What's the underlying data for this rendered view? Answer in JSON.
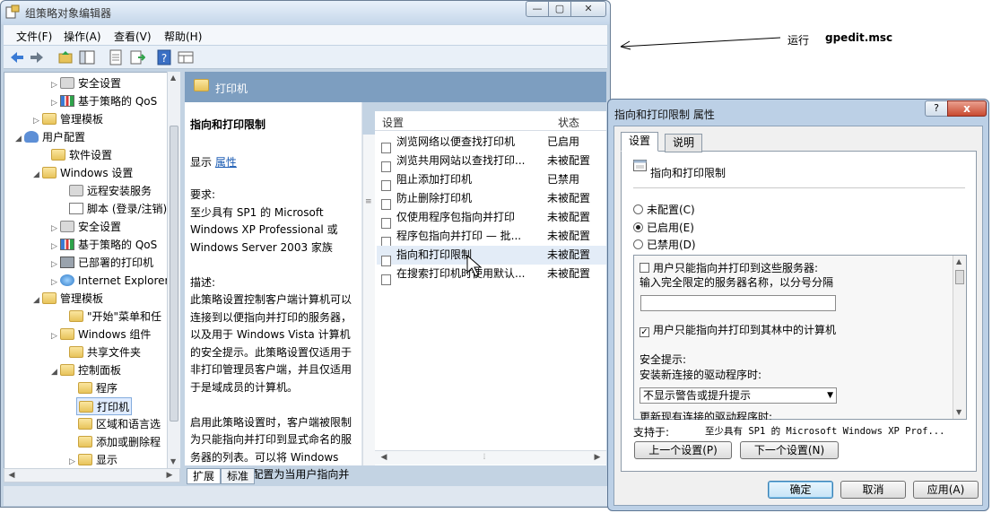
{
  "main_window": {
    "title": "组策略对象编辑器",
    "menu": [
      "文件(F)",
      "操作(A)",
      "查看(V)",
      "帮助(H)"
    ],
    "tree": [
      {
        "label": "安全设置",
        "icon": "security-settings-icon"
      },
      {
        "label": "基于策略的 QoS",
        "icon": "qos-chart-icon"
      },
      {
        "label": "管理模板",
        "icon": "folder-icon"
      },
      {
        "label": "用户配置",
        "icon": "user-config-icon"
      },
      {
        "label": "软件设置",
        "icon": "folder-icon"
      },
      {
        "label": "Windows 设置",
        "icon": "folder-icon"
      },
      {
        "label": "远程安装服务",
        "icon": "remote-install-icon"
      },
      {
        "label": "脚本 (登录/注销)",
        "icon": "script-icon"
      },
      {
        "label": "安全设置",
        "icon": "security-settings-icon"
      },
      {
        "label": "基于策略的 QoS",
        "icon": "qos-chart-icon"
      },
      {
        "label": "已部署的打印机",
        "icon": "printer-icon"
      },
      {
        "label": "Internet Explorer",
        "icon": "ie-globe-icon"
      },
      {
        "label": "管理模板",
        "icon": "folder-icon"
      },
      {
        "label": "\"开始\"菜单和任",
        "icon": "folder-icon"
      },
      {
        "label": "Windows 组件",
        "icon": "folder-icon"
      },
      {
        "label": "共享文件夹",
        "icon": "folder-icon"
      },
      {
        "label": "控制面板",
        "icon": "folder-icon"
      },
      {
        "label": "程序",
        "icon": "folder-icon"
      },
      {
        "label": "打印机",
        "icon": "folder-icon",
        "selected": true
      },
      {
        "label": "区域和语言选",
        "icon": "folder-icon"
      },
      {
        "label": "添加或删除程",
        "icon": "folder-icon"
      },
      {
        "label": "显示",
        "icon": "folder-icon"
      }
    ],
    "right_header_title": "打印机",
    "description": {
      "heading": "指向和打印限制",
      "show_prefix": "显示",
      "show_link": "属性",
      "body": "要求:\n至少具有 SP1 的 Microsoft\nWindows XP Professional 或\nWindows Server 2003 家族\n\n描述:\n此策略设置控制客户端计算机可以\n连接到以便指向并打印的服务器，\n以及用于 Windows Vista 计算机\n的安全提示。此策略设置仅适用于\n非打印管理员客户端，并且仅适用\n于是域成员的计算机。\n\n启用此策略设置时，客户端被限制\n为只能指向并打印到显式命名的服\n务器的列表。可以将 Windows\nVista 客户端配置为当用户指向并"
    },
    "list_columns": {
      "setting": "设置",
      "state": "状态"
    },
    "settings": [
      {
        "name": "浏览网络以便查找打印机",
        "state": "已启用"
      },
      {
        "name": "浏览共用网站以查找打印...",
        "state": "未被配置"
      },
      {
        "name": "阻止添加打印机",
        "state": "已禁用"
      },
      {
        "name": "防止删除打印机",
        "state": "未被配置"
      },
      {
        "name": "仅使用程序包指向并打印",
        "state": "未被配置"
      },
      {
        "name": "程序包指向并打印 — 批...",
        "state": "未被配置"
      },
      {
        "name": "指向和打印限制",
        "state": "未被配置",
        "highlighted": true
      },
      {
        "name": "在搜索打印机时使用默认...",
        "state": "未被配置"
      }
    ],
    "bottom_tabs": [
      "扩展",
      "标准"
    ]
  },
  "annotation": {
    "run_label": "运行",
    "command": "gpedit.msc"
  },
  "dialog": {
    "title": "指向和打印限制 属性",
    "close_label": "x",
    "help_label": "?",
    "tabs": [
      "设置",
      "说明"
    ],
    "policy_name": "指向和打印限制",
    "radios": [
      {
        "label": "未配置(C)",
        "checked": false
      },
      {
        "label": "已启用(E)",
        "checked": true
      },
      {
        "label": "已禁用(D)",
        "checked": false
      }
    ],
    "options": {
      "chk_servers_label": "用户只能指向并打印到这些服务器:",
      "chk_servers_checked": false,
      "server_names_label": "输入完全限定的服务器名称，以分号分隔",
      "server_names_value": "",
      "chk_forest_label": "用户只能指向并打印到其林中的计算机",
      "chk_forest_checked": true,
      "security_prompt_label": "安全提示:",
      "new_driver_label": "安装新连接的驱动程序时:",
      "new_driver_value": "不显示警告或提升提示",
      "update_driver_label": "更新现有连接的驱动程序时:"
    },
    "supported_label": "支持于:",
    "supported_value": "至少具有 SP1 的 Microsoft Windows XP Prof...",
    "buttons": {
      "prev": "上一个设置(P)",
      "next": "下一个设置(N)",
      "ok": "确定",
      "cancel": "取消",
      "apply": "应用(A)"
    }
  }
}
